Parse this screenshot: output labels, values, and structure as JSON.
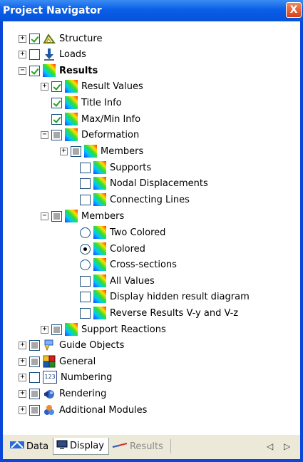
{
  "window": {
    "title": "Project Navigator",
    "close_glyph": "X"
  },
  "tree": {
    "structure": "Structure",
    "loads": "Loads",
    "results": "Results",
    "result_values": "Result Values",
    "title_info": "Title Info",
    "maxmin_info": "Max/Min Info",
    "deformation": "Deformation",
    "def_members": "Members",
    "supports": "Supports",
    "nodal_displacements": "Nodal Displacements",
    "connecting_lines": "Connecting Lines",
    "members": "Members",
    "two_colored": "Two Colored",
    "colored": "Colored",
    "cross_sections": "Cross-sections",
    "all_values": "All Values",
    "display_hidden": "Display hidden result diagram",
    "reverse_results": "Reverse Results V-y and V-z",
    "support_reactions": "Support Reactions",
    "guide_objects": "Guide Objects",
    "general": "General",
    "numbering": "Numbering",
    "rendering": "Rendering",
    "additional_modules": "Additional Modules",
    "numbering_icon_text": "123"
  },
  "tabs": {
    "data": "Data",
    "display": "Display",
    "results": "Results",
    "active": "display"
  },
  "nav": {
    "prev": "◁",
    "next": "▷"
  },
  "colors": {
    "title_bar": "#0553d9",
    "checkmark": "#21a121",
    "window_border": "#0a46d8"
  },
  "icons": {
    "results_icon": "rainbow-gradient-icon",
    "structure_icon": "structure-icon",
    "loads_icon": "load-arrow-icon",
    "guide_icon": "guide-objects-icon",
    "general_icon": "general-icon",
    "numbering_icon": "numbering-icon",
    "rendering_icon": "rendering-icon",
    "modules_icon": "additional-modules-icon"
  }
}
